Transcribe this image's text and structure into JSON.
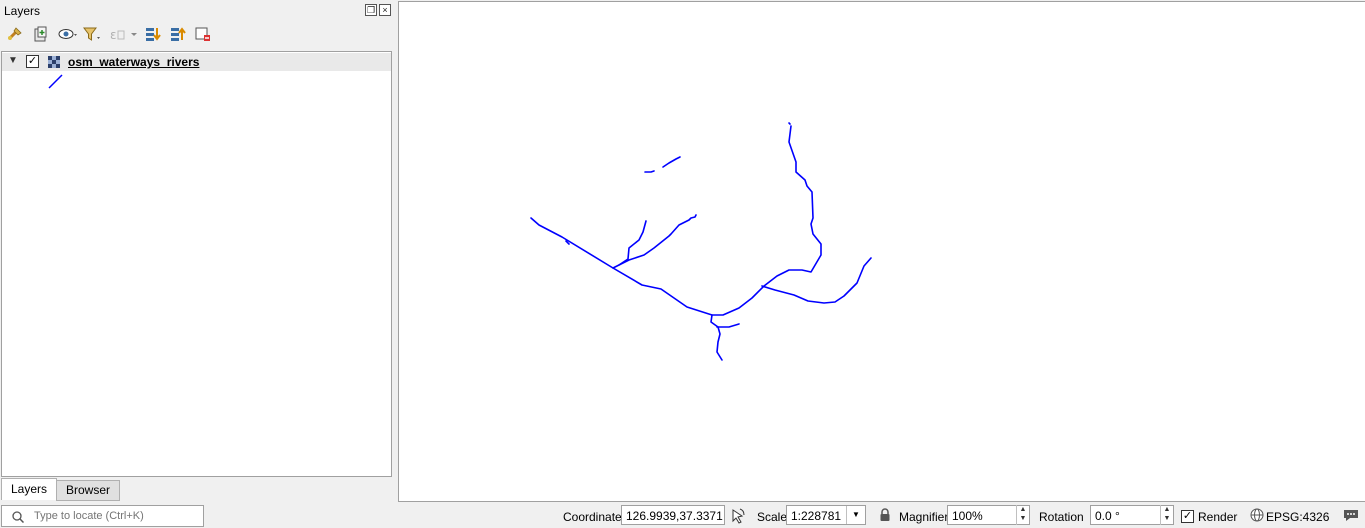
{
  "panel": {
    "title": "Layers",
    "float_icon": "float-icon",
    "close_icon": "close-icon",
    "toolbar": [
      "style-manager-icon",
      "add-group-icon",
      "visibility-eye-icon",
      "filter-legend-icon",
      "filter-expression-icon",
      "expand-all-icon",
      "collapse-all-icon",
      "remove-layer-icon"
    ],
    "layer": {
      "name": "osm_waterways_rivers",
      "visible": true,
      "icon": "line-layer-icon",
      "symbol_color": "#0000ff"
    },
    "tabs": [
      {
        "label": "Layers",
        "active": true
      },
      {
        "label": "Browser",
        "active": false
      }
    ]
  },
  "map": {
    "background": "#ffffff",
    "river_color": "#0000ff"
  },
  "statusbar": {
    "locator_placeholder": "Type to locate (Ctrl+K)",
    "coordinate_label": "Coordinate",
    "coordinate_value": "126.9939,37.3371",
    "scale_label": "Scale",
    "scale_value": "1:228781",
    "magnifier_label": "Magnifier",
    "magnifier_value": "100%",
    "rotation_label": "Rotation",
    "rotation_value": "0.0 °",
    "render_label": "Render",
    "render_checked": true,
    "crs_label": "EPSG:4326"
  }
}
